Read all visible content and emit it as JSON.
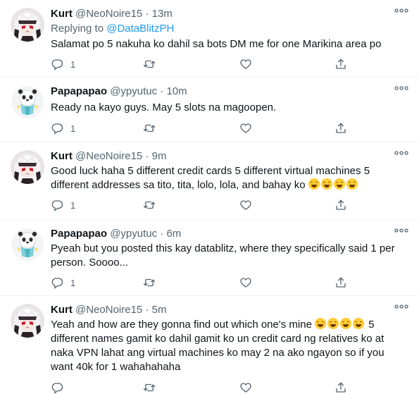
{
  "tweets": [
    {
      "name": "Kurt",
      "handle": "@NeoNoire15",
      "time": "13m",
      "replying_prefix": "Replying to",
      "replying_to": "@DataBlitzPH",
      "text": "Salamat po 5 nakuha ko dahil sa bots DM me for one Marikina area po",
      "reply_count": "1"
    },
    {
      "name": "Papapapao",
      "handle": "@ypyutuc",
      "time": "10m",
      "text": "Ready na kayo guys. May 5 slots na magoopen.",
      "reply_count": "1"
    },
    {
      "name": "Kurt",
      "handle": "@NeoNoire15",
      "time": "9m",
      "text": "Good luck haha 5 different credit cards 5 different virtual machines 5 different addresses sa tito, tita, lolo, lola, and bahay ko",
      "reply_count": "1"
    },
    {
      "name": "Papapapao",
      "handle": "@ypyutuc",
      "time": "6m",
      "text": "Pyeah but you posted this kay datablitz, where they specifically said 1 per person. Soooo...",
      "reply_count": "1"
    },
    {
      "name": "Kurt",
      "handle": "@NeoNoire15",
      "time": "5m",
      "text_before": "Yeah and how are they gonna find out which one's mine",
      "text_after": " 5 different names gamit ko dahil gamit ko un credit card ng relatives ko at naka VPN lahat ang virtual machines ko may 2 na ako ngayon so if you want 40k for 1 wahahahaha",
      "reply_count": ""
    }
  ],
  "separator": "·",
  "icons": {
    "reply": "reply-icon",
    "retweet": "retweet-icon",
    "like": "heart-icon",
    "share": "share-icon",
    "more": "more-icon"
  },
  "colors": {
    "link": "#1d9bf0",
    "secondary": "#536471",
    "text": "#0f1419"
  }
}
